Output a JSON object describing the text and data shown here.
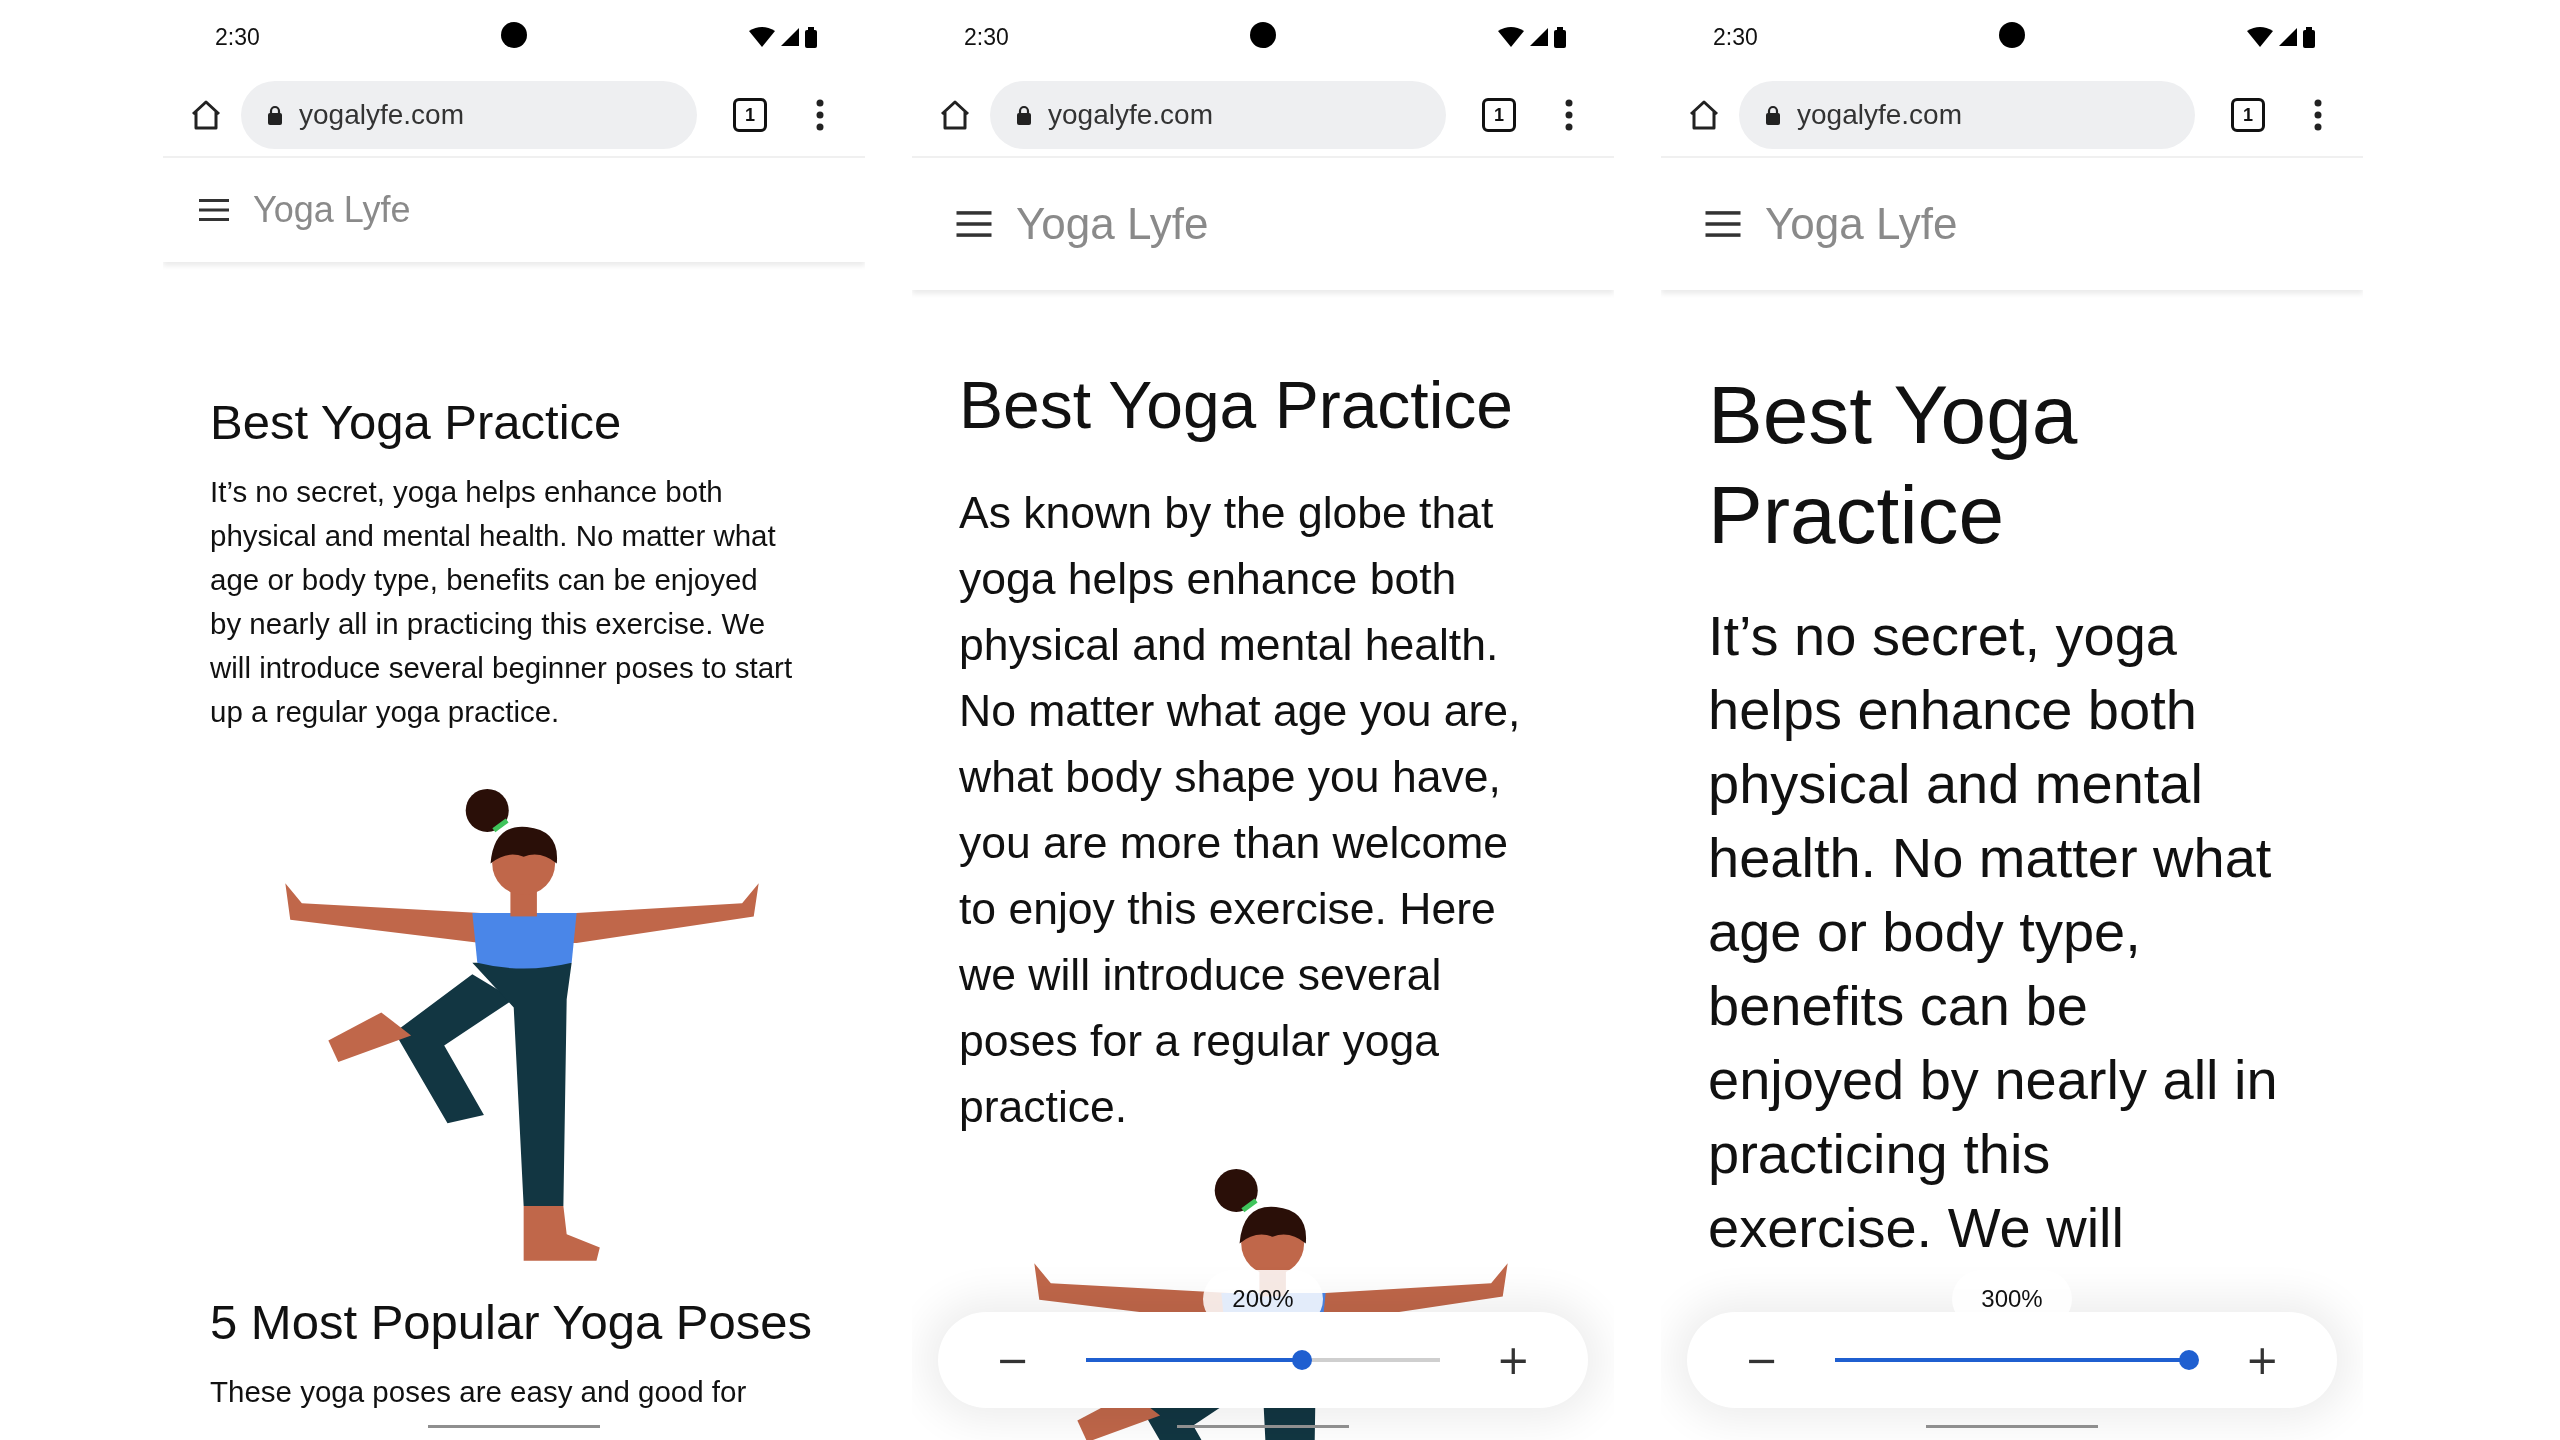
{
  "phones": [
    {
      "kind": "normal",
      "status_bar": {
        "time": "2:30"
      },
      "browser": {
        "url": "yogalyfe.com",
        "tab_count": "1"
      },
      "site": {
        "title": "Yoga Lyfe"
      },
      "content": [
        {
          "kind": "heading",
          "text": "Best Yoga Practice"
        },
        {
          "kind": "paragraph",
          "text": "It’s no secret, yoga helps enhance both physical and mental health. No matter what age or body type, benefits can be enjoyed by nearly all in practicing this exercise. We will introduce several beginner poses  to start up a regular yoga practice."
        },
        {
          "kind": "illustration"
        },
        {
          "kind": "heading",
          "text": "5 Most Popular Yoga Poses"
        },
        {
          "kind": "paragraph",
          "text": "These yoga poses are easy and good for"
        }
      ]
    },
    {
      "kind": "enlarged",
      "status_bar": {
        "time": "2:30"
      },
      "browser": {
        "url": "yogalyfe.com",
        "tab_count": "1"
      },
      "site": {
        "title": "Yoga Lyfe"
      },
      "content": [
        {
          "kind": "heading",
          "text": "Best Yoga Practice"
        },
        {
          "kind": "paragraph",
          "text": "As known by the globe that yoga helps enhance both physical and mental health. No matter what age you are, what body shape you have, you are more than welcome to enjoy this exercise. Here we will introduce several poses for a regular yoga practice."
        },
        {
          "kind": "illustration"
        }
      ],
      "zoom_control": {
        "label": "200%",
        "level": 0.61,
        "zoom_out": "−",
        "zoom_in": "+"
      }
    },
    {
      "kind": "maximal",
      "status_bar": {
        "time": "2:30"
      },
      "browser": {
        "url": "yogalyfe.com",
        "tab_count": "1"
      },
      "site": {
        "title": "Yoga Lyfe"
      },
      "content": [
        {
          "kind": "heading",
          "text": "Best Yoga Practice"
        },
        {
          "kind": "paragraph",
          "text": "It’s no secret, yoga helps enhance both physical and mental health. No matter what age or body type, benefits can be enjoyed by nearly all in practicing this exercise. We will"
        }
      ],
      "zoom_control": {
        "label": "300%",
        "level": 1,
        "zoom_out": "−",
        "zoom_in": "+"
      }
    }
  ]
}
